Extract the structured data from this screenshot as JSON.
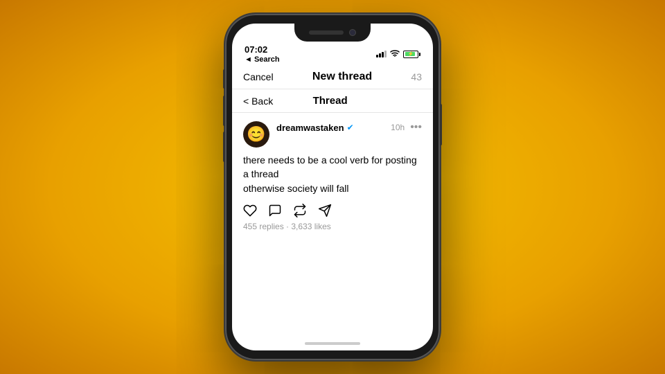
{
  "background": {
    "gradient_start": "#f5c200",
    "gradient_end": "#c87800"
  },
  "phone": {
    "status_bar": {
      "time": "07:02",
      "search_label": "◄ Search",
      "char_count": "43"
    },
    "new_thread_header": {
      "cancel_label": "Cancel",
      "title": "New thread",
      "char_count": "43"
    },
    "inner_nav": {
      "back_label": "< Back",
      "title": "Thread"
    },
    "post": {
      "username": "dreamwastaken",
      "verified": true,
      "time": "10h",
      "more": "•••",
      "text_line1": "there needs to be a cool verb for posting a thread",
      "text_line2": "otherwise society will fall",
      "stats": "455 replies · 3,633 likes"
    },
    "actions": {
      "like": "heart",
      "comment": "bubble",
      "repost": "repost",
      "share": "send"
    }
  }
}
